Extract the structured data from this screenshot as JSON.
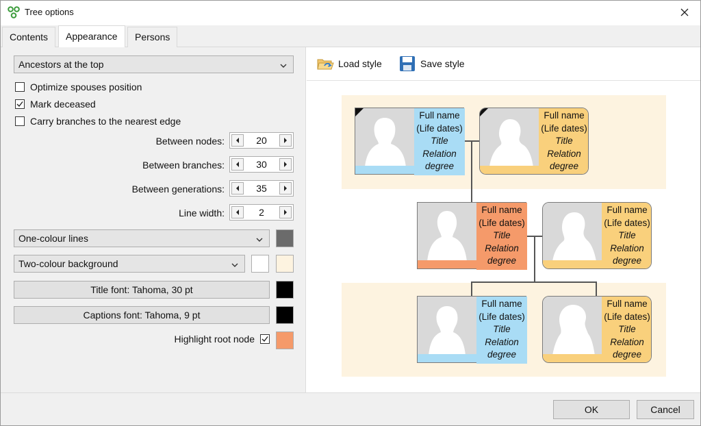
{
  "window": {
    "title": "Tree options",
    "close_icon": "close-icon"
  },
  "tabs": [
    {
      "label": "Contents",
      "active": false
    },
    {
      "label": "Appearance",
      "active": true
    },
    {
      "label": "Persons",
      "active": false
    }
  ],
  "appearance": {
    "layout_select": "Ancestors at the top",
    "checkboxes": [
      {
        "label": "Optimize spouses position",
        "checked": false
      },
      {
        "label": "Mark deceased",
        "checked": true
      },
      {
        "label": "Carry branches to the nearest edge",
        "checked": false
      }
    ],
    "spinners": [
      {
        "label": "Between nodes:",
        "value": "20"
      },
      {
        "label": "Between branches:",
        "value": "30"
      },
      {
        "label": "Between generations:",
        "value": "35"
      },
      {
        "label": "Line width:",
        "value": "2"
      }
    ],
    "lines_select": "One-colour lines",
    "line_color": "#6b6b6b",
    "background_select": "Two-colour background",
    "background_colors": [
      "#ffffff",
      "#fdf3e0"
    ],
    "title_font_button": "Title font: Tahoma, 30 pt",
    "title_font_color": "#000000",
    "captions_font_button": "Captions font: Tahoma, 9 pt",
    "captions_font_color": "#000000",
    "highlight_root": {
      "label": "Highlight root node",
      "checked": true,
      "color": "#f59a6a"
    }
  },
  "preview": {
    "load_style": "Load style",
    "save_style": "Save style",
    "card": {
      "line1": "Full name",
      "line2": "(Life dates)",
      "line3": "Title",
      "line4": "Relation",
      "line5": "degree"
    },
    "colors": {
      "male": "#a9dcf5",
      "female": "#f9d07c",
      "root": "#f59a6a",
      "band": "#fdf3e0"
    }
  },
  "footer": {
    "ok": "OK",
    "cancel": "Cancel"
  }
}
